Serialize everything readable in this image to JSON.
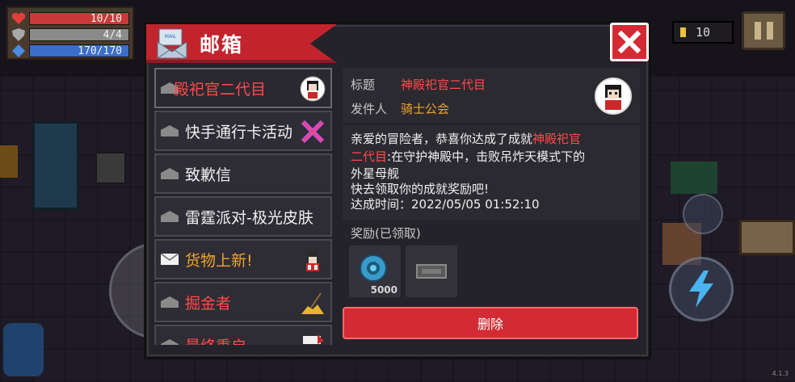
{
  "hud": {
    "hp": "10/10",
    "armor": "4/4",
    "energy": "170/170",
    "coins": "10",
    "version": "4.1.3"
  },
  "mailbox": {
    "title": "邮箱",
    "close_icon": "close-x-icon",
    "items": [
      {
        "label": "殿祀官二代目",
        "style": "red",
        "art": "priest-avatar-icon"
      },
      {
        "label": "快手通行卡活动",
        "style": "white",
        "art": "crossed-swords-icon"
      },
      {
        "label": "致歉信",
        "style": "white",
        "art": ""
      },
      {
        "label": "雷霆派对-极光皮肤",
        "style": "white",
        "art": ""
      },
      {
        "label": "货物上新!",
        "style": "gold",
        "art": "merchant-icon"
      },
      {
        "label": "掘金者",
        "style": "red",
        "art": "gold-pile-icon"
      },
      {
        "label": "最终重启",
        "style": "red",
        "art": "final-icon"
      }
    ],
    "detail": {
      "title_label": "标题",
      "title_value": "神殿祀官二代目",
      "sender_label": "发件人",
      "sender_value": "骑士公会",
      "body": {
        "line1_prefix": "亲爱的冒险者，恭喜你达成了成就",
        "line1_highlight": "神殿祀官",
        "line2_highlight": "二代目",
        "line2_suffix": ":在守护神殿中，击败吊炸天模式下的",
        "line3": "外星母舰",
        "line4": "快去领取你的成就奖励吧!",
        "line5": "达成时间：2022/05/05 01:52:10"
      },
      "reward_title": "奖励(已领取)",
      "rewards": [
        {
          "icon": "gem-coin-icon",
          "count": "5000"
        },
        {
          "icon": "ticket-icon",
          "count": ""
        }
      ],
      "delete_label": "删除"
    }
  },
  "colors": {
    "accent_red": "#d42a34",
    "highlight_red": "#ff4a4a",
    "gold": "#f0a42a"
  }
}
